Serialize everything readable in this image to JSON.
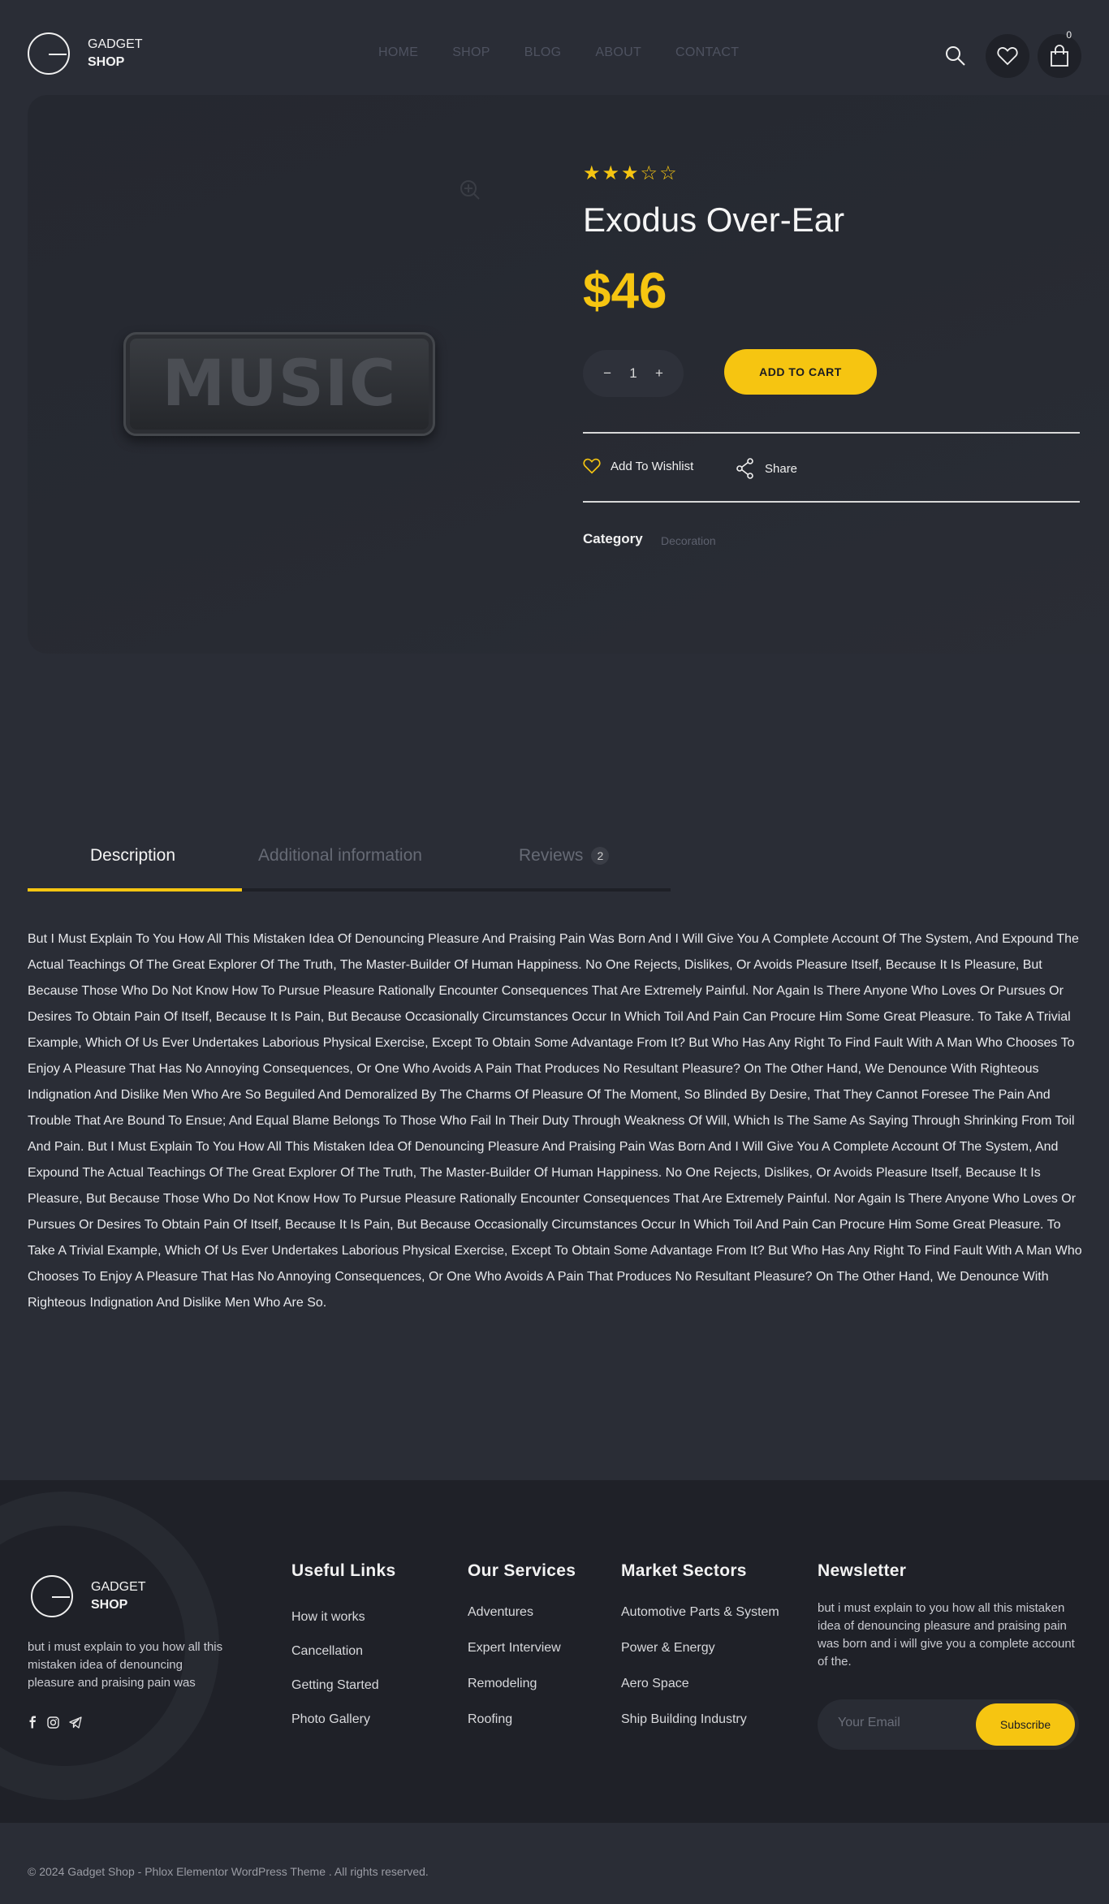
{
  "brand": {
    "line1": "GADGET",
    "line2": "SHOP"
  },
  "nav": {
    "items": [
      "HOME",
      "SHOP",
      "BLOG",
      "ABOUT",
      "CONTACT"
    ]
  },
  "header": {
    "cart_count": "0"
  },
  "product": {
    "image_text": "MUSIC",
    "rating": {
      "filled": "★★★",
      "empty": "☆☆",
      "value": 3,
      "max": 5
    },
    "title": "Exodus Over-Ear",
    "price": "$46",
    "quantity": "1",
    "qty_minus": "−",
    "qty_plus": "+",
    "add_to_cart": "ADD TO CART",
    "wishlist": "Add To Wishlist",
    "share": "Share",
    "category_label": "Category",
    "category_value": "Decoration"
  },
  "tabs": {
    "description": "Description",
    "additional": "Additional information",
    "reviews": "Reviews",
    "reviews_count": "2"
  },
  "description_text": "But I Must Explain To You How All This Mistaken Idea Of Denouncing Pleasure And Praising Pain Was Born And I Will Give You A Complete Account Of The System, And Expound The Actual Teachings Of The Great Explorer Of The Truth, The Master-Builder Of Human Happiness. No One Rejects, Dislikes, Or Avoids Pleasure Itself, Because It Is Pleasure, But Because Those Who Do Not Know How To Pursue Pleasure Rationally Encounter Consequences That Are Extremely Painful. Nor Again Is There Anyone Who Loves Or Pursues Or Desires To Obtain Pain Of Itself, Because It Is Pain, But Because Occasionally Circumstances Occur In Which Toil And Pain Can Procure Him Some Great Pleasure. To Take A Trivial Example, Which Of Us Ever Undertakes Laborious Physical Exercise, Except To Obtain Some Advantage From It? But Who Has Any Right To Find Fault With A Man Who Chooses To Enjoy A Pleasure That Has No Annoying Consequences, Or One Who Avoids A Pain That Produces No Resultant Pleasure? On The Other Hand, We Denounce With Righteous Indignation And Dislike Men Who Are So Beguiled And Demoralized By The Charms Of Pleasure Of The Moment, So Blinded By Desire, That They Cannot Foresee The Pain And Trouble That Are Bound To Ensue; And Equal Blame Belongs To Those Who Fail In Their Duty Through Weakness Of Will, Which Is The Same As Saying Through Shrinking From Toil And Pain. But I Must Explain To You How All This Mistaken Idea Of Denouncing Pleasure And Praising Pain Was Born And I Will Give You A Complete Account Of The System, And Expound The Actual Teachings Of The Great Explorer Of The Truth, The Master-Builder Of Human Happiness. No One Rejects, Dislikes, Or Avoids Pleasure Itself, Because It Is Pleasure, But Because Those Who Do Not Know How To Pursue Pleasure Rationally Encounter Consequences That Are Extremely Painful. Nor Again Is There Anyone Who Loves Or Pursues Or Desires To Obtain Pain Of Itself, Because It Is Pain, But Because Occasionally Circumstances Occur In Which Toil And Pain Can Procure Him Some Great Pleasure. To Take A Trivial Example, Which Of Us Ever Undertakes Laborious Physical Exercise, Except To Obtain Some Advantage From It? But Who Has Any Right To Find Fault With A Man Who Chooses To Enjoy A Pleasure That Has No Annoying Consequences, Or One Who Avoids A Pain That Produces No Resultant Pleasure? On The Other Hand, We Denounce With Righteous Indignation And Dislike Men Who Are So.",
  "footer": {
    "about": "but i must explain to you how all this mistaken idea of denouncing pleasure and praising pain was",
    "useful_links": {
      "title": "Useful Links",
      "items": [
        "How it works",
        "Cancellation",
        "Getting Started",
        "Photo Gallery"
      ]
    },
    "services": {
      "title": "Our Services",
      "items": [
        "Adventures",
        "Expert Interview",
        "Remodeling",
        "Roofing"
      ]
    },
    "market": {
      "title": "Market Sectors",
      "items": [
        "Automotive Parts & System",
        "Power & Energy",
        "Aero Space",
        "Ship Building Industry"
      ]
    },
    "newsletter": {
      "title": "Newsletter",
      "text": "but i must explain to you how all this mistaken idea of denouncing pleasure and praising pain was born and i will give you a complete account of the.",
      "placeholder": "Your Email",
      "button": "Subscribe"
    },
    "copyright": "© 2024 Gadget Shop - Phlox Elementor WordPress Theme . All rights reserved."
  },
  "colors": {
    "accent": "#f6c511",
    "background": "#2a2d36",
    "footer": "#1f2128"
  },
  "icons": [
    "search-icon",
    "heart-icon",
    "bag-icon",
    "zoom-icon",
    "share-icon",
    "facebook-icon",
    "instagram-icon",
    "telegram-icon"
  ]
}
